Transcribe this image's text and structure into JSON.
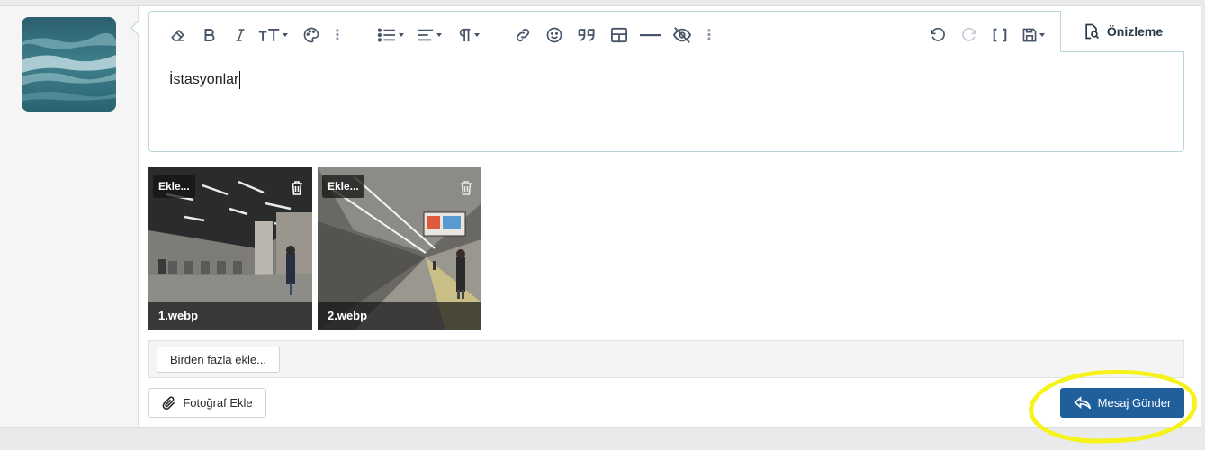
{
  "toolbar": {
    "items": [
      {
        "icon": "eraser-icon"
      },
      {
        "icon": "bold-icon"
      },
      {
        "icon": "italic-icon"
      },
      {
        "icon": "text-size-icon"
      },
      {
        "icon": "palette-icon"
      },
      {
        "icon": "more-dots-icon"
      },
      {
        "icon": "list-icon"
      },
      {
        "icon": "align-icon"
      },
      {
        "icon": "paragraph-icon"
      },
      {
        "icon": "link-icon"
      },
      {
        "icon": "emoji-icon"
      },
      {
        "icon": "quote-icon"
      },
      {
        "icon": "table-icon"
      },
      {
        "icon": "horizontal-rule-icon"
      },
      {
        "icon": "hide-icon"
      },
      {
        "icon": "more-dots-icon"
      },
      {
        "icon": "undo-icon"
      },
      {
        "icon": "redo-icon"
      },
      {
        "icon": "brackets-icon"
      },
      {
        "icon": "save-draft-icon"
      }
    ],
    "preview_label": "Önizleme"
  },
  "editor": {
    "content": "İstasyonlar"
  },
  "attachments": [
    {
      "badge": "Ekle...",
      "filename": "1.webp"
    },
    {
      "badge": "Ekle...",
      "filename": "2.webp"
    }
  ],
  "buttons": {
    "add_multiple": "Birden fazla ekle...",
    "add_photo": "Fotoğraf Ekle",
    "send": "Mesaj Gönder"
  },
  "colors": {
    "send_button": "#1f5f9c",
    "highlight": "#f6f21a",
    "editor_border": "#b9d6da"
  }
}
